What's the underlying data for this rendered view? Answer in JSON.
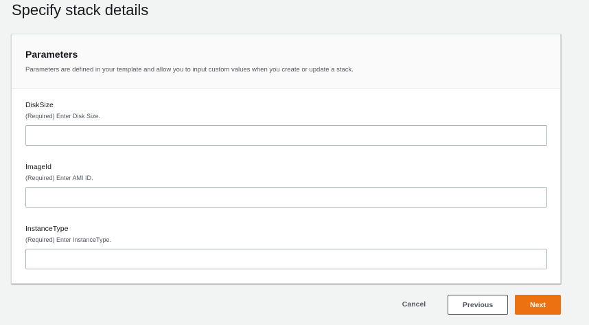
{
  "page": {
    "title": "Specify stack details"
  },
  "parameters": {
    "title": "Parameters",
    "description": "Parameters are defined in your template and allow you to input custom values when you create or update a stack.",
    "fields": [
      {
        "label": "DiskSize",
        "hint": "(Required) Enter Disk Size.",
        "value": ""
      },
      {
        "label": "ImageId",
        "hint": "(Required) Enter AMI ID.",
        "value": ""
      },
      {
        "label": "InstanceType",
        "hint": "(Required) Enter InstanceType.",
        "value": ""
      }
    ]
  },
  "actions": {
    "cancel_label": "Cancel",
    "previous_label": "Previous",
    "next_label": "Next"
  },
  "colors": {
    "primary": "#ec7211",
    "background": "#f2f3f3",
    "text": "#16191f",
    "secondary_text": "#545b64"
  }
}
